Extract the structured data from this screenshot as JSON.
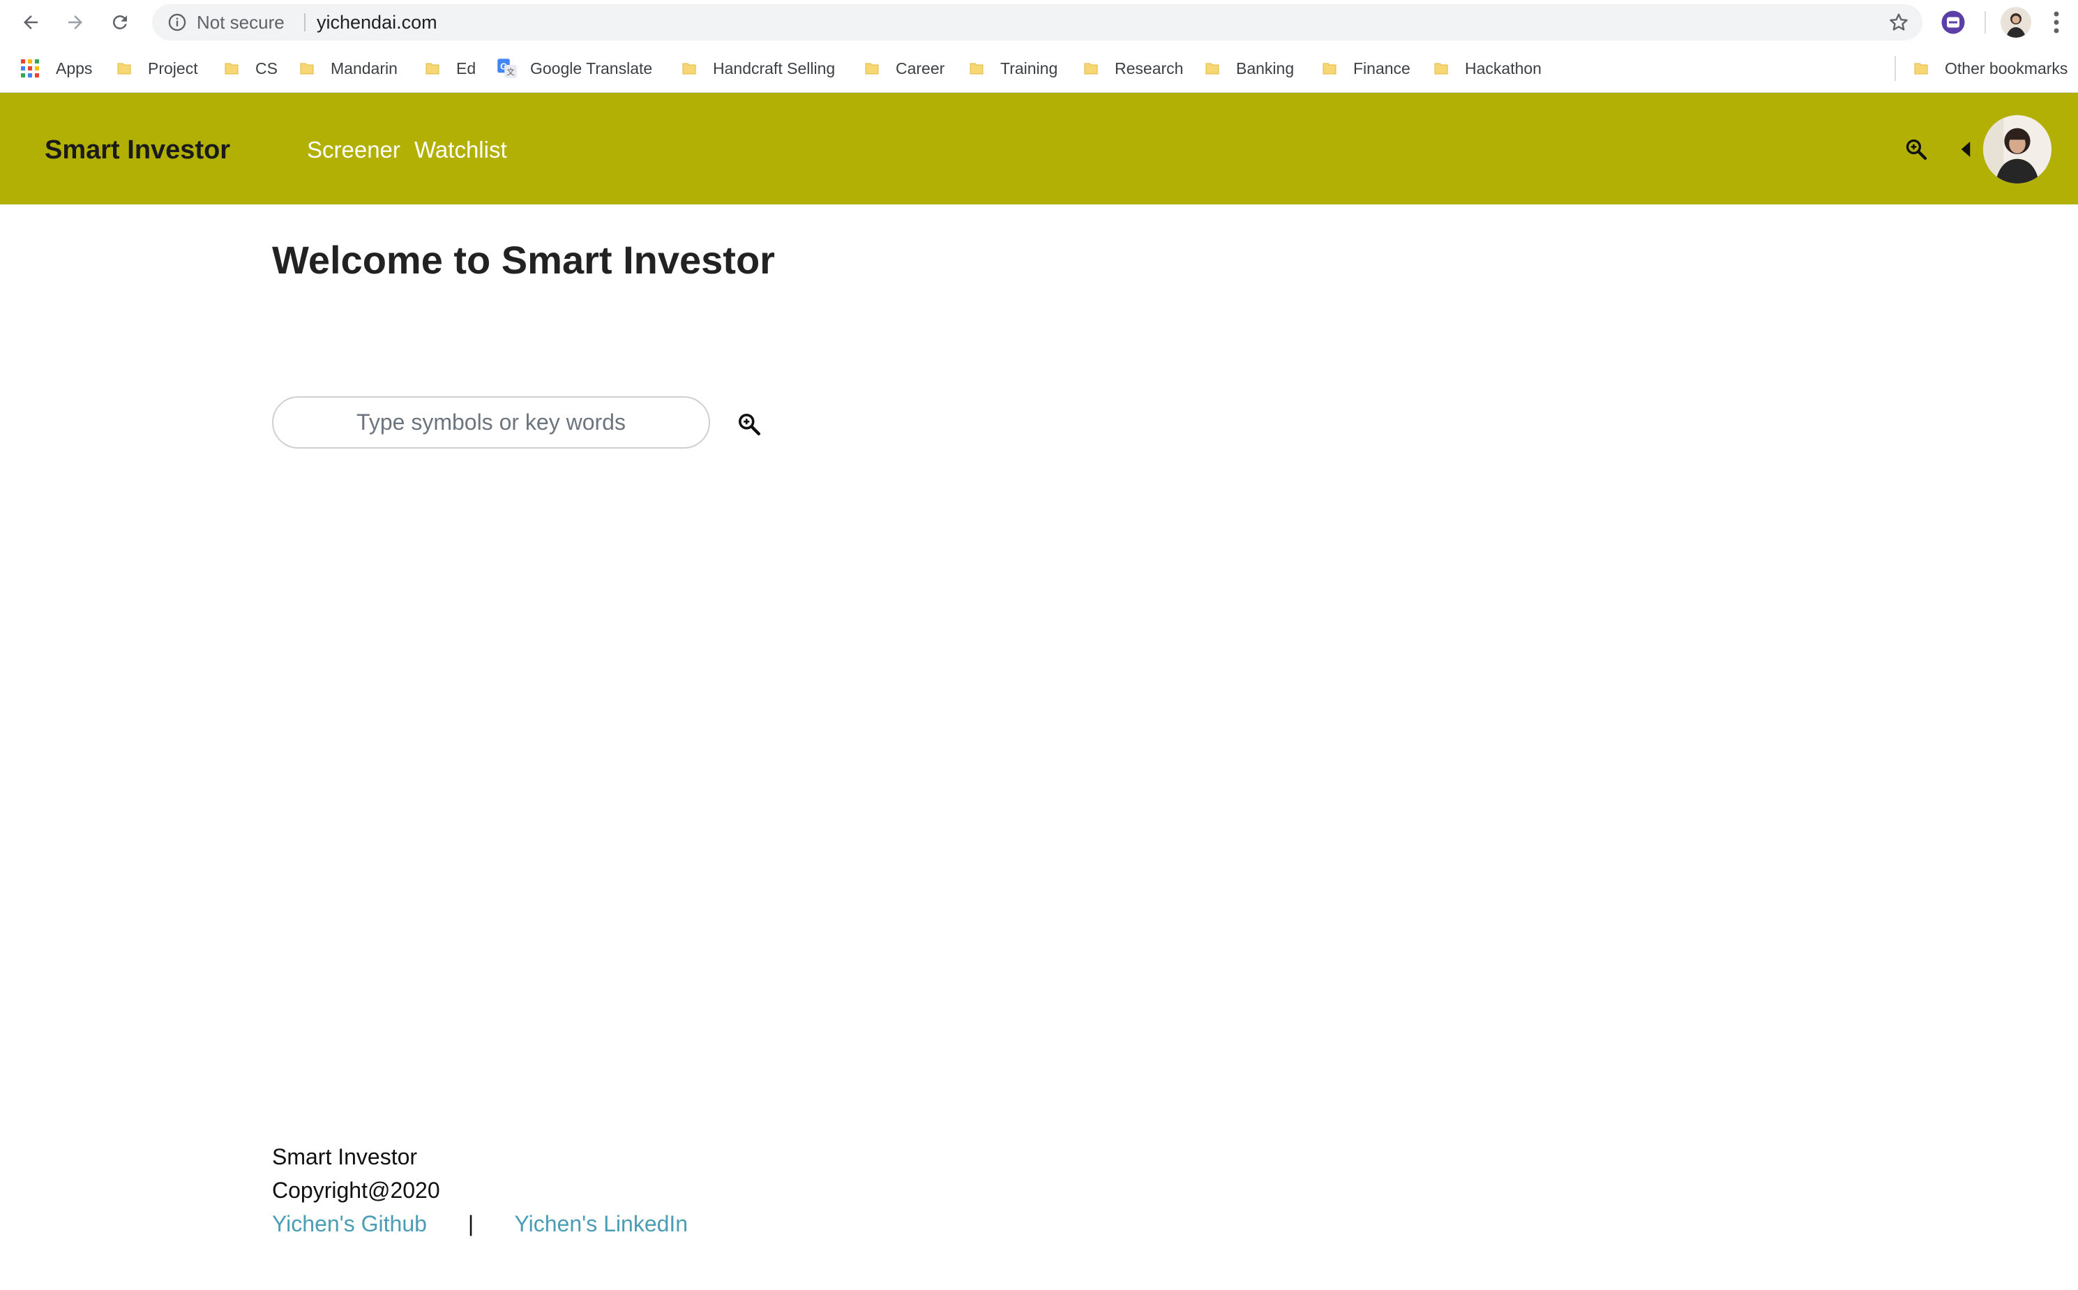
{
  "browser": {
    "security_label": "Not secure",
    "url": "yichendai.com",
    "icons": {
      "back": "arrow-left-icon",
      "forward": "arrow-right-icon",
      "reload": "reload-icon",
      "info": "info-icon",
      "bookmark": "star-icon",
      "extension": "extension-icon",
      "profile": "profile-avatar",
      "menu": "kebab-menu-icon"
    }
  },
  "bookmarks": {
    "apps_label": "Apps",
    "items": [
      {
        "label": "Project",
        "icon": "folder-icon"
      },
      {
        "label": "CS",
        "icon": "folder-icon"
      },
      {
        "label": "Mandarin",
        "icon": "folder-icon"
      },
      {
        "label": "Ed",
        "icon": "folder-icon"
      },
      {
        "label": "Google Translate",
        "icon": "google-translate-icon"
      },
      {
        "label": "Handcraft Selling",
        "icon": "folder-icon"
      },
      {
        "label": "Career",
        "icon": "folder-icon"
      },
      {
        "label": "Training",
        "icon": "folder-icon"
      },
      {
        "label": "Research",
        "icon": "folder-icon"
      },
      {
        "label": "Banking",
        "icon": "folder-icon"
      },
      {
        "label": "Finance",
        "icon": "folder-icon"
      },
      {
        "label": "Hackathon",
        "icon": "folder-icon"
      }
    ],
    "other_label": "Other bookmarks"
  },
  "navbar": {
    "brand": "Smart Investor",
    "links": [
      {
        "label": "Screener"
      },
      {
        "label": "Watchlist"
      }
    ],
    "background": "#b3b005"
  },
  "main": {
    "title": "Welcome to Smart Investor",
    "search": {
      "placeholder": "Type symbols or key words",
      "value": ""
    }
  },
  "footer": {
    "name": "Smart Investor",
    "copyright": "Copyright@2020",
    "github_label": "Yichen's Github",
    "separator": "|",
    "linkedin_label": "Yichen's LinkedIn",
    "link_color": "#4a9db5"
  }
}
